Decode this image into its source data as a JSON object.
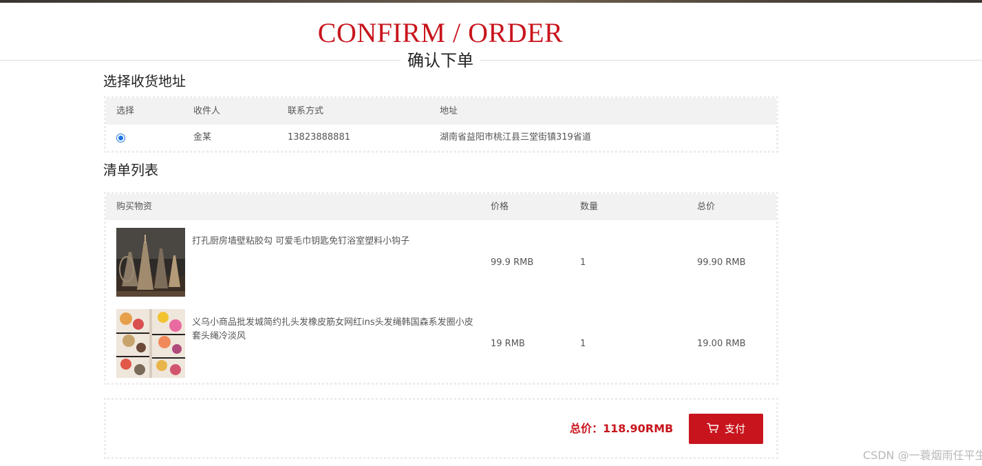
{
  "header": {
    "title_en": "CONFIRM / ORDER",
    "title_cn": "确认下单"
  },
  "address_section": {
    "title": "选择收货地址",
    "columns": [
      "选择",
      "收件人",
      "联系方式",
      "地址"
    ],
    "rows": [
      {
        "selected": true,
        "recipient": "金某",
        "phone": "13823888881",
        "address": "湖南省益阳市桃江县三堂街镇319省道"
      }
    ]
  },
  "list_section": {
    "title": "清单列表",
    "columns": [
      "购买物资",
      "价格",
      "数量",
      "总价"
    ],
    "items": [
      {
        "name": "打孔厨房墙壁粘胶勾 可爱毛巾钥匙免钉浴室塑料小钩子",
        "price": "99.9 RMB",
        "qty": "1",
        "subtotal": "99.90 RMB"
      },
      {
        "name": "义乌小商品批发城简约扎头发橡皮筋女网红ins头发绳韩国森系发圈小皮套头绳冷淡风",
        "price": "19 RMB",
        "qty": "1",
        "subtotal": "19.00 RMB"
      }
    ]
  },
  "summary": {
    "total_label": "总价：118.90RMB",
    "pay_label": "支付",
    "pay_icon": "cart-icon"
  },
  "watermark": "CSDN @一蓑烟雨任平生",
  "colors": {
    "accent_red": "#c8151d",
    "header_gray": "#f2f2f2",
    "radio_blue": "#1a73e8"
  }
}
